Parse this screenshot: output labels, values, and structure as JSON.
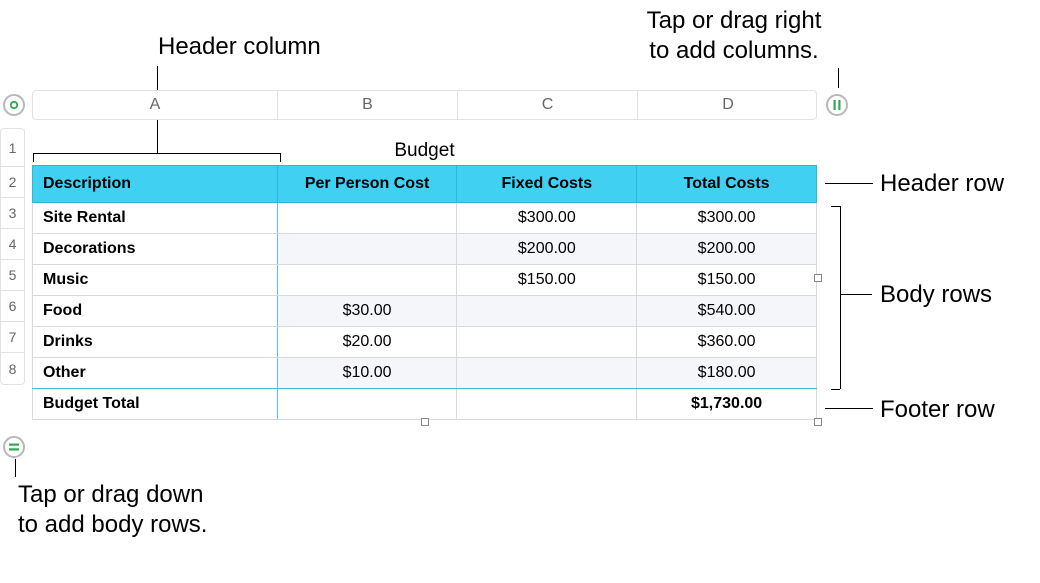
{
  "callouts": {
    "header_column": "Header column",
    "add_columns_line1": "Tap or drag right",
    "add_columns_line2": "to add columns.",
    "header_row": "Header row",
    "body_rows": "Body rows",
    "footer_row": "Footer row",
    "add_rows_line1": "Tap or drag down",
    "add_rows_line2": "to add body rows."
  },
  "columns": [
    "A",
    "B",
    "C",
    "D"
  ],
  "row_numbers": [
    "1",
    "2",
    "3",
    "4",
    "5",
    "6",
    "7",
    "8"
  ],
  "table": {
    "title": "Budget",
    "headers": [
      "Description",
      "Per Person Cost",
      "Fixed Costs",
      "Total Costs"
    ],
    "rows": [
      {
        "desc": "Site Rental",
        "per": "",
        "fixed": "$300.00",
        "total": "$300.00"
      },
      {
        "desc": "Decorations",
        "per": "",
        "fixed": "$200.00",
        "total": "$200.00"
      },
      {
        "desc": "Music",
        "per": "",
        "fixed": "$150.00",
        "total": "$150.00"
      },
      {
        "desc": "Food",
        "per": "$30.00",
        "fixed": "",
        "total": "$540.00"
      },
      {
        "desc": "Drinks",
        "per": "$20.00",
        "fixed": "",
        "total": "$360.00"
      },
      {
        "desc": "Other",
        "per": "$10.00",
        "fixed": "",
        "total": "$180.00"
      }
    ],
    "footer": {
      "desc": "Budget Total",
      "per": "",
      "fixed": "",
      "total": "$1,730.00"
    }
  },
  "icons": {
    "corner": "circle",
    "add_col": "pause",
    "add_row": "equals"
  },
  "colors": {
    "header_bg": "#3fd0f2",
    "alt_row": "#f4f6f9"
  }
}
